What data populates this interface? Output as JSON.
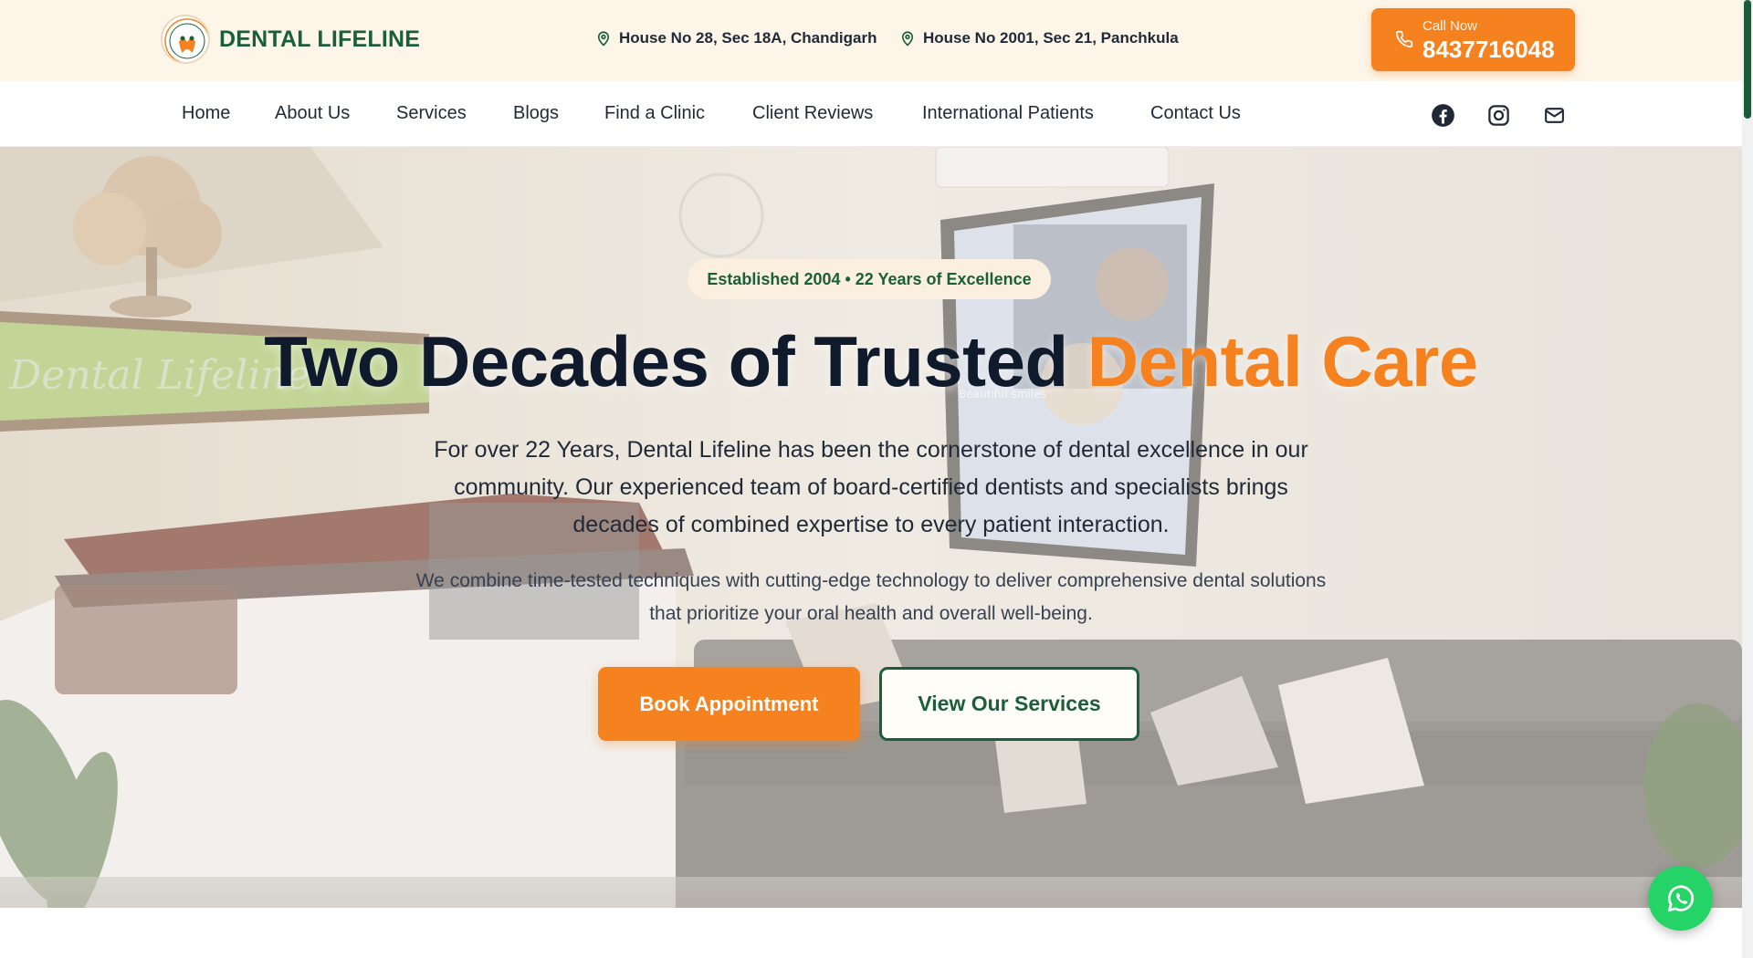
{
  "brand": {
    "name": "DENTAL LIFELINE",
    "logo_text": "Dental Lifeline"
  },
  "addresses": [
    {
      "text": "House No 28, Sec 18A, Chandigarh",
      "icon": "map-pin-icon"
    },
    {
      "text": "House No 2001, Sec 21, Panchkula",
      "icon": "map-pin-icon"
    }
  ],
  "call": {
    "label": "Call Now",
    "number": "8437716048",
    "icon": "phone-icon"
  },
  "nav": {
    "items": [
      "Home",
      "About Us",
      "Services",
      "Blogs",
      "Find a Clinic",
      "Client Reviews",
      "International Patients",
      "Contact Us"
    ],
    "social": [
      "facebook-icon",
      "instagram-icon",
      "mail-icon"
    ]
  },
  "hero": {
    "badge": "Established 2004 • 22 Years of Excellence",
    "title_main": "Two Decades of Trusted ",
    "title_accent": "Dental Care",
    "lead": "For over 22 Years, Dental Lifeline has been the cornerstone of dental excellence in our community. Our experienced team of board-certified dentists and specialists brings decades of combined expertise to every patient interaction.",
    "sub": "We combine time-tested techniques with cutting-edge technology to deliver comprehensive dental solutions that prioritize your oral health and overall well-being.",
    "book_button": "Book Appointment",
    "services_button": "View Our Services",
    "background_sign": "Dental Lifeline",
    "poster_caption": "Beautiful smiles"
  },
  "colors": {
    "accent": "#f5821f",
    "brand_green": "#1b5e3a",
    "dark_text": "#0f1b2d",
    "topbar_bg": "#fdf5e8",
    "whatsapp": "#25d366"
  },
  "floating": {
    "whatsapp_icon": "whatsapp-icon"
  }
}
